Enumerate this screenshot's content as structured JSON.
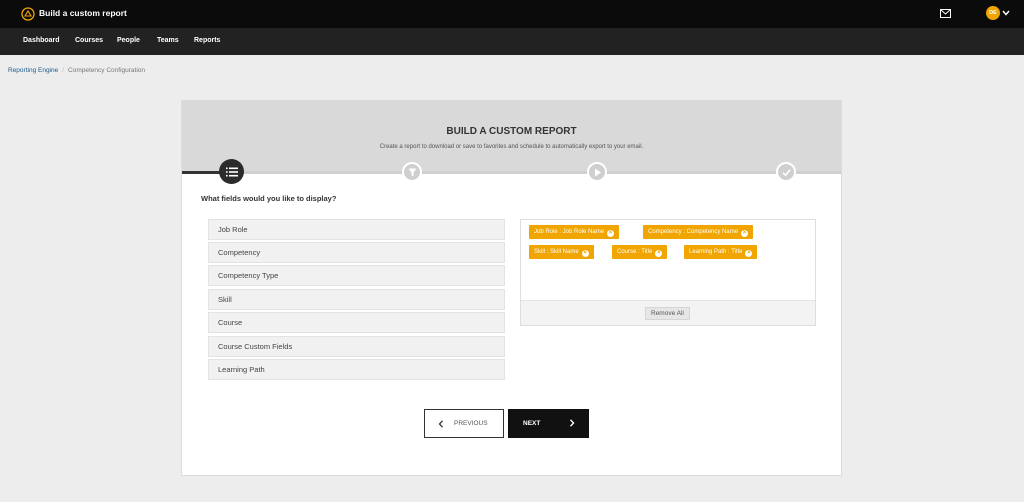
{
  "app": {
    "title": "Build a custom report",
    "avatar_initials": "DE",
    "accent": "#f0a500"
  },
  "nav": {
    "items": [
      {
        "label": "Dashboard"
      },
      {
        "label": "Courses"
      },
      {
        "label": "People"
      },
      {
        "label": "Teams"
      },
      {
        "label": "Reports"
      }
    ]
  },
  "breadcrumb": {
    "parent": "Reporting Engine",
    "current": "Competency Configuration"
  },
  "builder": {
    "title": "BUILD A CUSTOM REPORT",
    "subtitle": "Create a report to download or save to favorites and schedule to automatically export to your email.",
    "steps": [
      {
        "icon": "list-icon",
        "state": "active"
      },
      {
        "icon": "filter-icon",
        "state": "pending"
      },
      {
        "icon": "play-icon",
        "state": "pending"
      },
      {
        "icon": "check-icon",
        "state": "pending"
      }
    ],
    "question": "What fields would you like to display?",
    "fields": [
      {
        "label": "Job Role"
      },
      {
        "label": "Competency"
      },
      {
        "label": "Competency Type"
      },
      {
        "label": "Skill"
      },
      {
        "label": "Course"
      },
      {
        "label": "Course Custom Fields"
      },
      {
        "label": "Learning Path"
      }
    ],
    "selected": [
      {
        "label": "Job Role : Job Role Name"
      },
      {
        "label": "Competency : Competency Name"
      },
      {
        "label": "Skill : Skill Name"
      },
      {
        "label": "Course : Title"
      },
      {
        "label": "Learning Path : Title"
      }
    ],
    "remove_all_label": "Remove All",
    "previous_label": "PREVIOUS",
    "next_label": "NEXT"
  }
}
